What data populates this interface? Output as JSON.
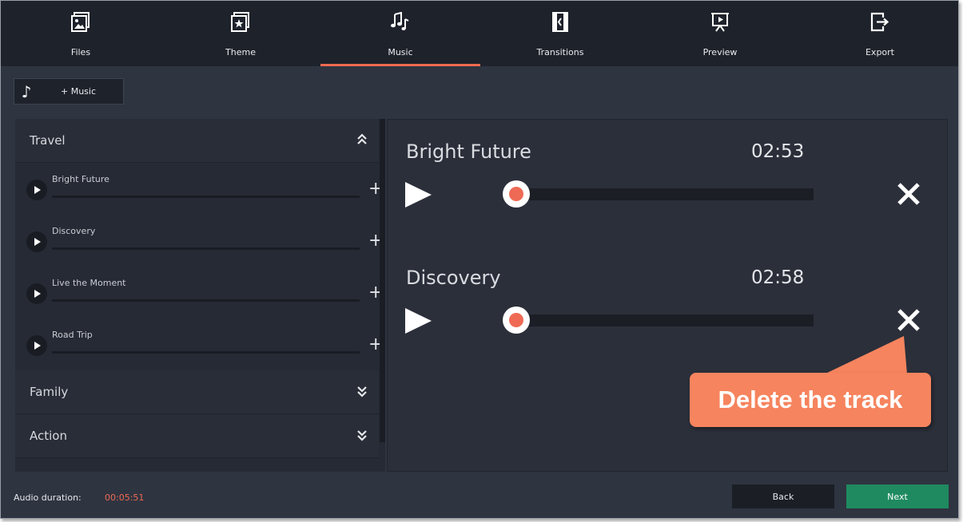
{
  "nav": {
    "tabs": [
      {
        "label": "Files",
        "icon": "files-icon"
      },
      {
        "label": "Theme",
        "icon": "theme-icon"
      },
      {
        "label": "Music",
        "icon": "music-icon",
        "active": true
      },
      {
        "label": "Transitions",
        "icon": "transitions-icon"
      },
      {
        "label": "Preview",
        "icon": "preview-icon"
      },
      {
        "label": "Export",
        "icon": "export-icon"
      }
    ],
    "active_underline_color": "#ee6a50"
  },
  "toolbar": {
    "add_music_icon": "music-note-icon",
    "add_music_label": "+ Music"
  },
  "library": {
    "categories": [
      {
        "label": "Travel",
        "expanded": true,
        "tracks": [
          {
            "name": "Bright Future"
          },
          {
            "name": "Discovery"
          },
          {
            "name": "Live the Moment"
          },
          {
            "name": "Road Trip"
          }
        ]
      },
      {
        "label": "Family",
        "expanded": false
      },
      {
        "label": "Action",
        "expanded": false
      }
    ]
  },
  "selected_tracks": [
    {
      "title": "Bright Future",
      "duration": "02:53",
      "progress": 0
    },
    {
      "title": "Discovery",
      "duration": "02:58",
      "progress": 0
    }
  ],
  "callout": {
    "text": "Delete the track",
    "color": "#f6845e"
  },
  "footer": {
    "duration_label": "Audio duration:",
    "duration_value": "00:05:51",
    "back_label": "Back",
    "next_label": "Next",
    "next_color": "#1f8a60"
  }
}
